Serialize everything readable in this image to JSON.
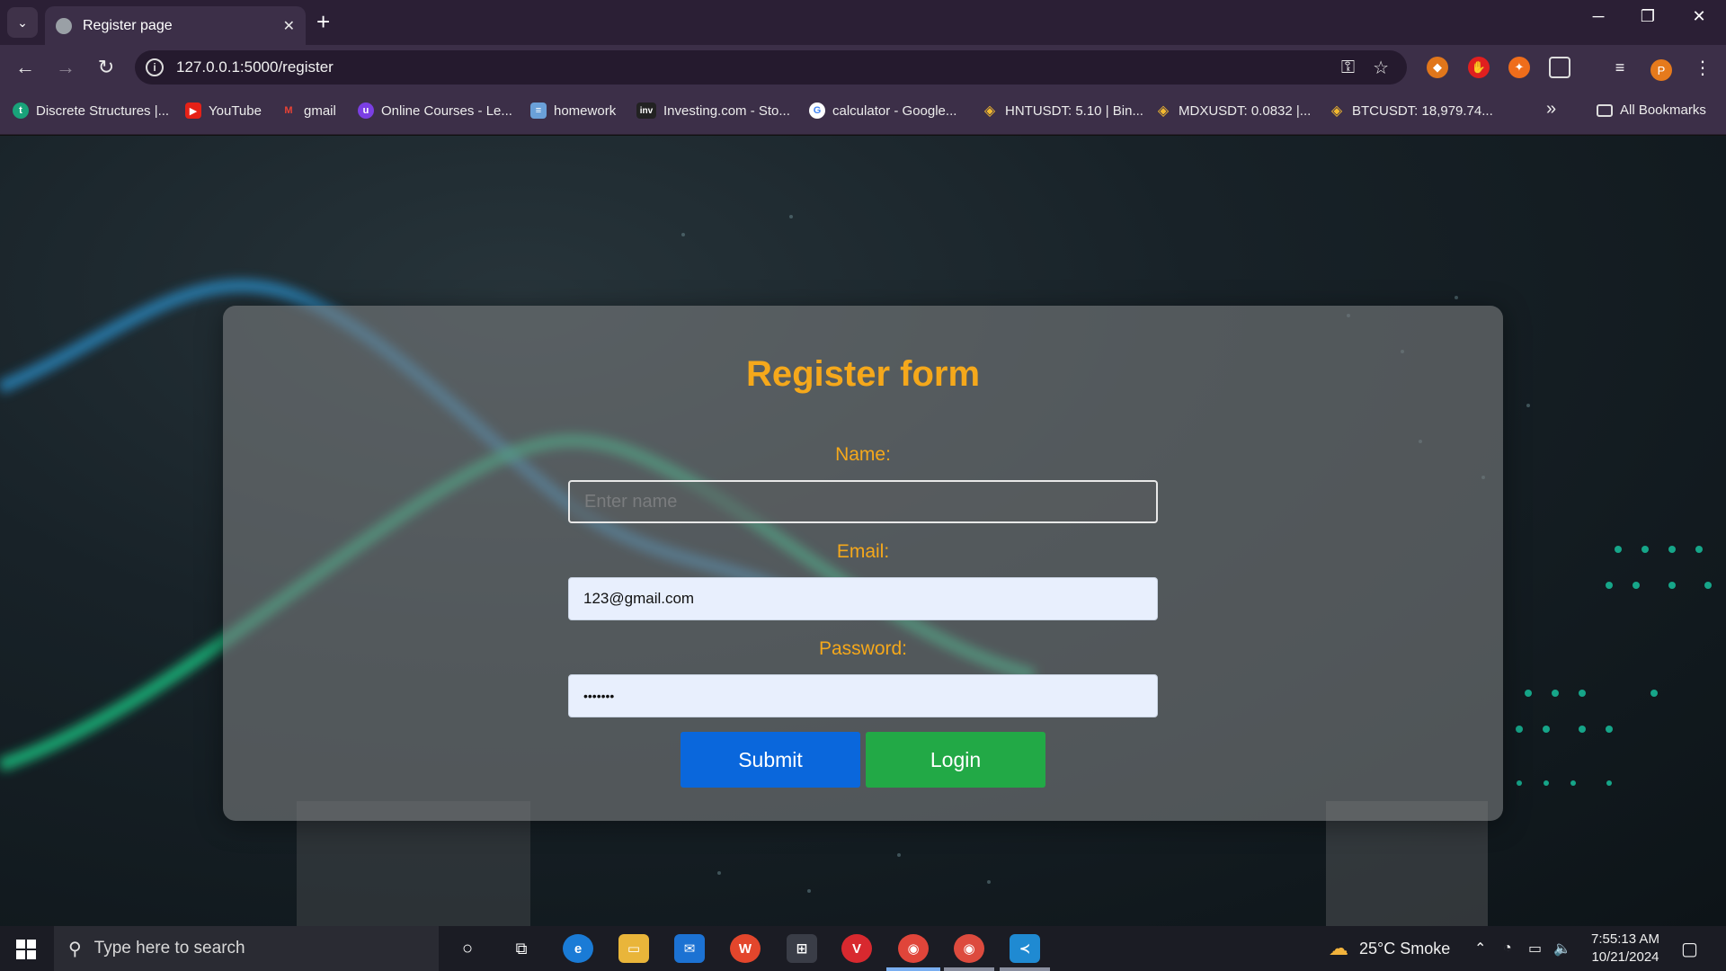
{
  "tab": {
    "title": "Register page",
    "close": "✕"
  },
  "address": {
    "url": "127.0.0.1:5000/register"
  },
  "avatar_letter": "P",
  "bookmarks": [
    {
      "label": "Discrete Structures |...",
      "icon": "tutor-icon",
      "color": "#19a37a"
    },
    {
      "label": "YouTube",
      "icon": "youtube-icon",
      "color": "#e62117"
    },
    {
      "label": "gmail",
      "icon": "gmail-icon",
      "color": "#ea4335"
    },
    {
      "label": "Online Courses - Le...",
      "icon": "udemy-icon",
      "color": "#7b3fe4"
    },
    {
      "label": "homework",
      "icon": "stack-icon",
      "color": "#6aa0d8"
    },
    {
      "label": "Investing.com - Sto...",
      "icon": "investing-icon",
      "color": "#222222"
    },
    {
      "label": "calculator - Google...",
      "icon": "google-icon",
      "color": "#ffffff"
    },
    {
      "label": "HNTUSDT: 5.10 | Bin...",
      "icon": "binance-icon",
      "color": "#f3ba2f"
    },
    {
      "label": "MDXUSDT: 0.0832 |...",
      "icon": "binance-icon",
      "color": "#f3ba2f"
    },
    {
      "label": "BTCUSDT: 18,979.74...",
      "icon": "binance-icon",
      "color": "#f3ba2f"
    }
  ],
  "bookmarks_more": "»",
  "all_bookmarks": "All Bookmarks",
  "form": {
    "title": "Register form",
    "name_label": "Name:",
    "name_placeholder": "Enter name",
    "email_label": "Email:",
    "email_value": "123@gmail.com",
    "password_label": "Password:",
    "password_value": "•••••••",
    "submit_label": "Submit",
    "login_label": "Login"
  },
  "taskbar": {
    "search_placeholder": "Type here to search",
    "weather": "25°C  Smoke",
    "time": "7:55:13 AM",
    "date": "10/21/2024"
  },
  "colors": {
    "accent_title": "#f5a81b",
    "submit": "#0a67dc",
    "login": "#22a946"
  }
}
